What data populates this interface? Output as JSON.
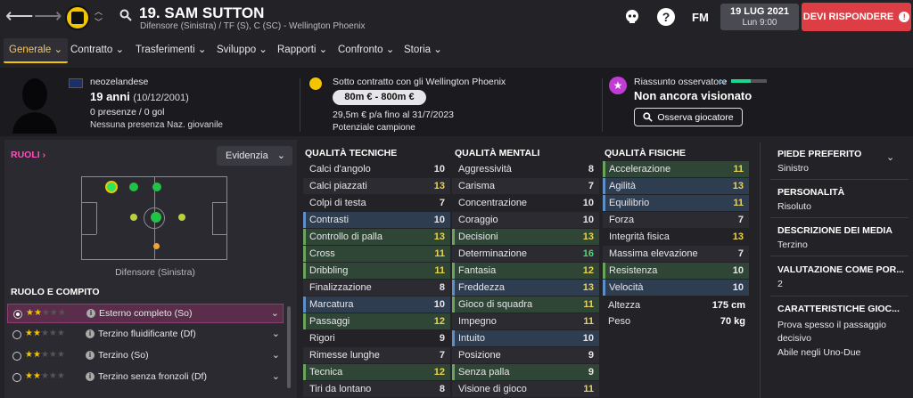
{
  "header": {
    "player_title": "19. SAM SUTTON",
    "subtitle": "Difensore (Sinistra) / TF (S), C (SC) - Wellington Phoenix",
    "date": "19 LUG 2021",
    "time": "Lun 9:00",
    "fm_label": "FM",
    "help_label": "?",
    "reply_label": "DEVI RISPONDERE",
    "reply_badge": "!"
  },
  "menu": [
    {
      "label": "Generale ⌄",
      "active": true
    },
    {
      "label": "Contratto ⌄"
    },
    {
      "label": "Trasferimenti ⌄"
    },
    {
      "label": "Sviluppo ⌄"
    },
    {
      "label": "Rapporti ⌄"
    },
    {
      "label": "Confronto ⌄"
    },
    {
      "label": "Storia ⌄"
    }
  ],
  "profile": {
    "nationality": "neozelandese",
    "age": "19 anni",
    "dob": "(10/12/2001)",
    "appearances": "0 presenze / 0 gol",
    "international": "Nessuna presenza Naz. giovanile"
  },
  "contract": {
    "title": "Sotto contratto con gli Wellington Phoenix",
    "value": "80m € - 800m €",
    "wage": "29,5m € p/a fino al 31/7/2023",
    "potential": "Potenziale campione"
  },
  "scout": {
    "title": "Riassunto osservatore",
    "status": "Non ancora visionato",
    "button": "Osserva giocatore",
    "progress": 0.55,
    "infinity": "∞"
  },
  "roles": {
    "link": "RUOLI",
    "highlight_label": "Evidenzia",
    "position_label": "Difensore (Sinistra)",
    "section_title": "RUOLO E COMPITO",
    "items": [
      {
        "name": "Esterno completo (So)",
        "stars": 1.5,
        "selected": true
      },
      {
        "name": "Terzino fluidificante (Df)",
        "stars": 1.5
      },
      {
        "name": "Terzino (So)",
        "stars": 1.5
      },
      {
        "name": "Terzino senza fronzoli (Df)",
        "stars": 1.5
      }
    ],
    "pitch_dots": [
      {
        "level": "natural",
        "color": "#2ee65a"
      },
      {
        "level": "accomplished",
        "color": "#22c244"
      },
      {
        "level": "competent",
        "color": "#b7d240"
      },
      {
        "level": "unconvincing",
        "color": "#f2a33a"
      }
    ]
  },
  "technical": {
    "title": "QUALITÀ TECNICHE",
    "rows": [
      {
        "name": "Calci d'angolo",
        "value": "10"
      },
      {
        "name": "Calci piazzati",
        "value": "13"
      },
      {
        "name": "Colpi di testa",
        "value": "7"
      },
      {
        "name": "Contrasti",
        "value": "10",
        "style": "hl"
      },
      {
        "name": "Controllo di palla",
        "value": "13",
        "style": "gr"
      },
      {
        "name": "Cross",
        "value": "11",
        "style": "gr"
      },
      {
        "name": "Dribbling",
        "value": "11",
        "style": "gr"
      },
      {
        "name": "Finalizzazione",
        "value": "8"
      },
      {
        "name": "Marcatura",
        "value": "10",
        "style": "hl"
      },
      {
        "name": "Passaggi",
        "value": "12",
        "style": "gr"
      },
      {
        "name": "Rigori",
        "value": "9"
      },
      {
        "name": "Rimesse lunghe",
        "value": "7"
      },
      {
        "name": "Tecnica",
        "value": "12",
        "style": "gr"
      },
      {
        "name": "Tiri da lontano",
        "value": "8"
      }
    ]
  },
  "mental": {
    "title": "QUALITÀ MENTALI",
    "rows": [
      {
        "name": "Aggressività",
        "value": "8"
      },
      {
        "name": "Carisma",
        "value": "7"
      },
      {
        "name": "Concentrazione",
        "value": "10"
      },
      {
        "name": "Coraggio",
        "value": "10"
      },
      {
        "name": "Decisioni",
        "value": "13",
        "style": "gr"
      },
      {
        "name": "Determinazione",
        "value": "16"
      },
      {
        "name": "Fantasia",
        "value": "12",
        "style": "gr"
      },
      {
        "name": "Freddezza",
        "value": "13",
        "style": "hl"
      },
      {
        "name": "Gioco di squadra",
        "value": "11",
        "style": "gr"
      },
      {
        "name": "Impegno",
        "value": "11"
      },
      {
        "name": "Intuito",
        "value": "10",
        "style": "hl"
      },
      {
        "name": "Posizione",
        "value": "9"
      },
      {
        "name": "Senza palla",
        "value": "9",
        "style": "gr"
      },
      {
        "name": "Visione di gioco",
        "value": "11"
      }
    ]
  },
  "physical": {
    "title": "QUALITÀ FISICHE",
    "rows": [
      {
        "name": "Accelerazione",
        "value": "11",
        "style": "gr"
      },
      {
        "name": "Agilità",
        "value": "13",
        "style": "hl"
      },
      {
        "name": "Equilibrio",
        "value": "11",
        "style": "hl"
      },
      {
        "name": "Forza",
        "value": "7"
      },
      {
        "name": "Integrità fisica",
        "value": "13"
      },
      {
        "name": "Massima elevazione",
        "value": "7"
      },
      {
        "name": "Resistenza",
        "value": "10",
        "style": "gr"
      },
      {
        "name": "Velocità",
        "value": "10",
        "style": "hl"
      }
    ],
    "height_label": "Altezza",
    "height": "175 cm",
    "weight_label": "Peso",
    "weight": "70 kg"
  },
  "info": {
    "foot_title": "PIEDE PREFERITO",
    "foot": "Sinistro",
    "personality_title": "PERSONALITÀ",
    "personality": "Risoluto",
    "media_title": "DESCRIZIONE DEI MEDIA",
    "media": "Terzino",
    "rating_title": "VALUTAZIONE COME POR...",
    "rating": "2",
    "traits_title": "CARATTERISTICHE GIOC...",
    "trait1": "Prova spesso il passaggio",
    "trait1b": "decisivo",
    "trait2": "Abile negli Uno-Due"
  }
}
